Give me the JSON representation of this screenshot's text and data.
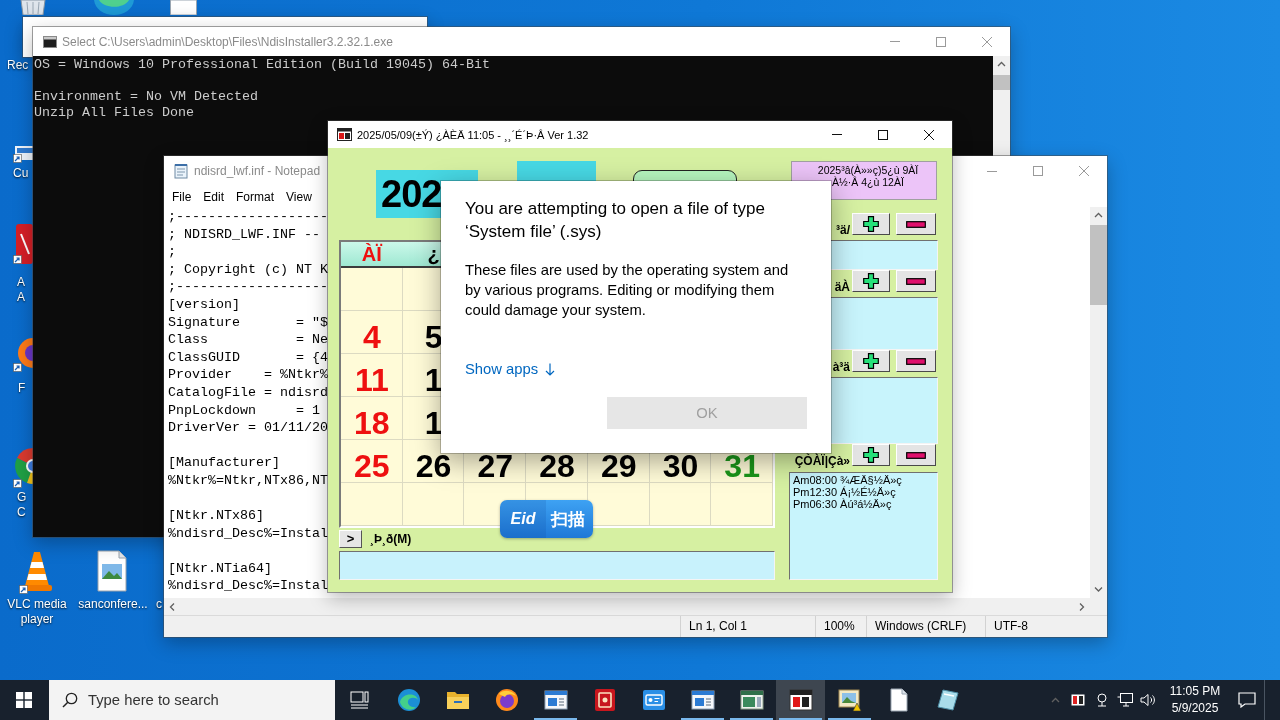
{
  "desktop_icons": [
    {
      "kind": "bin",
      "lines": [
        "Rec"
      ]
    },
    {
      "kind": "shortcut-tile",
      "lines": [
        "Cu"
      ]
    },
    {
      "kind": "shortcut-bar",
      "lines": [
        "A",
        "A"
      ]
    },
    {
      "kind": "shortcut-globe",
      "lines": [
        "F"
      ]
    },
    {
      "kind": "shortcut-ring",
      "lines": [
        "G",
        "C"
      ]
    },
    {
      "kind": "cone",
      "lines": [
        "VLC media",
        "player"
      ]
    },
    {
      "kind": "picture",
      "lines": [
        "sanconfere..."
      ]
    },
    {
      "lines": [
        "c"
      ]
    }
  ],
  "console": {
    "title": "Select C:\\Users\\admin\\Desktop\\Files\\NdisInstaller3.2.32.1.exe",
    "active": false,
    "blocks": [
      [
        "OS = Windows 10 Professional Edition (Build 19045) 64-Bit"
      ],
      [
        "Environment = No VM Detected",
        "Unzip All Files Done"
      ]
    ]
  },
  "notepad": {
    "title": "ndisrd_lwf.inf - Notepad",
    "active": false,
    "menu": [
      "File",
      "Edit",
      "Format",
      "View"
    ],
    "blocks": [
      [
        ";-------------------",
        "; NDISRD_LWF.INF --",
        ";",
        "; Copyright (c) NT K",
        ";-------------------",
        "[version]",
        "Signature       = \"$",
        "Class           = Ne",
        "ClassGUID       = {4",
        "Provider    = %Ntkr%",
        "CatalogFile = ndisrd",
        "PnpLockdown     = 1",
        "DriverVer = 01/11/20"
      ],
      [
        "[Manufacturer]",
        "%Ntkr%=Ntkr,NTx86,NT"
      ],
      [
        "[Ntkr.NTx86]",
        "%ndisrd_Desc%=Instal"
      ],
      [
        "[Ntkr.NTia64]",
        "%ndisrd_Desc%=Instal"
      ]
    ],
    "status": [
      "Ln 1, Col 1",
      "100%",
      "Windows (CRLF)",
      "UTF-8"
    ]
  },
  "calendar": {
    "title": "2025/05/09(±Ý) ¿ÀÈÄ 11:05 - ¸¸´É´Þ·Â Ver 1.32",
    "active": true,
    "year": "202",
    "date_info": [
      "2025³â(À»»ç)5¿ù 9ÀÏ",
      "À½·Â 4¿ù 12ÀÏ"
    ],
    "weekdays": [
      {
        "label": "ÀÏ",
        "kind": "sunday"
      },
      {
        "label": "¿",
        "kind": "weekday"
      }
    ],
    "weeks": [
      [
        {
          "day": "4",
          "kind": "sunday"
        },
        {
          "day": "5",
          "kind": "weekday"
        }
      ],
      [
        {
          "day": "11",
          "kind": "sunday"
        },
        {
          "day": "1",
          "kind": "weekday"
        }
      ],
      [
        {
          "day": "18",
          "kind": "sunday"
        },
        {
          "day": "1",
          "kind": "weekday"
        }
      ],
      [
        {
          "day": "25",
          "kind": "sunday"
        },
        {
          "day": "26",
          "kind": "weekday"
        },
        {
          "day": "27",
          "kind": "weekday"
        },
        {
          "day": "28",
          "kind": "weekday"
        },
        {
          "day": "29",
          "kind": "weekday"
        },
        {
          "day": "30",
          "kind": "weekday"
        },
        {
          "day": "31",
          "kind": "saturday"
        }
      ]
    ],
    "memo_toggle": ">",
    "memo_label": "¸Þ¸ð(M)",
    "sections": [
      {
        "label": "³ä/",
        "kind": "box"
      },
      {
        "label": "äÀ",
        "kind": "box"
      },
      {
        "label": "à³ä",
        "kind": "box"
      },
      {
        "label": "ÇÒÀÏ|Çà»",
        "kind": "list",
        "entries": [
          "Am08:00 ¾ÆÄ§½Ä»ç",
          "Pm12:30 Á¡½É½Ä»ç",
          "Pm06:30 Àú³á½Ä»ç"
        ]
      }
    ]
  },
  "scan_badge": {
    "logo": "Eid",
    "label": "扫描"
  },
  "dialog": {
    "title": "You are attempting to open a file of type ‘System file’ (.sys)",
    "message": "These files are used by the operating system and by various programs. Editing or modifying them could damage your system.",
    "link": "Show apps",
    "button": {
      "label": "OK",
      "disabled": true
    }
  },
  "taskbar": {
    "search": {
      "placeholder": "Type here to search"
    },
    "apps": [
      {
        "kind": "task-view",
        "open": false,
        "selected": false
      },
      {
        "kind": "swirl",
        "open": false,
        "selected": false
      },
      {
        "kind": "folder",
        "open": false,
        "selected": false
      },
      {
        "kind": "globe",
        "open": false,
        "selected": false
      },
      {
        "kind": "window",
        "open": true,
        "selected": false
      },
      {
        "kind": "stamp",
        "open": false,
        "selected": false
      },
      {
        "kind": "id-tile",
        "open": false,
        "selected": false
      },
      {
        "kind": "window",
        "open": true,
        "selected": false
      },
      {
        "kind": "panel",
        "open": true,
        "selected": false
      },
      {
        "kind": "calendar",
        "open": true,
        "selected": true
      },
      {
        "kind": "picture-warning",
        "open": true,
        "selected": false
      },
      {
        "kind": "document",
        "open": false,
        "selected": false
      },
      {
        "kind": "glass",
        "open": false,
        "selected": false
      }
    ],
    "clock": {
      "time": "11:05 PM",
      "date": "5/9/2025"
    }
  }
}
